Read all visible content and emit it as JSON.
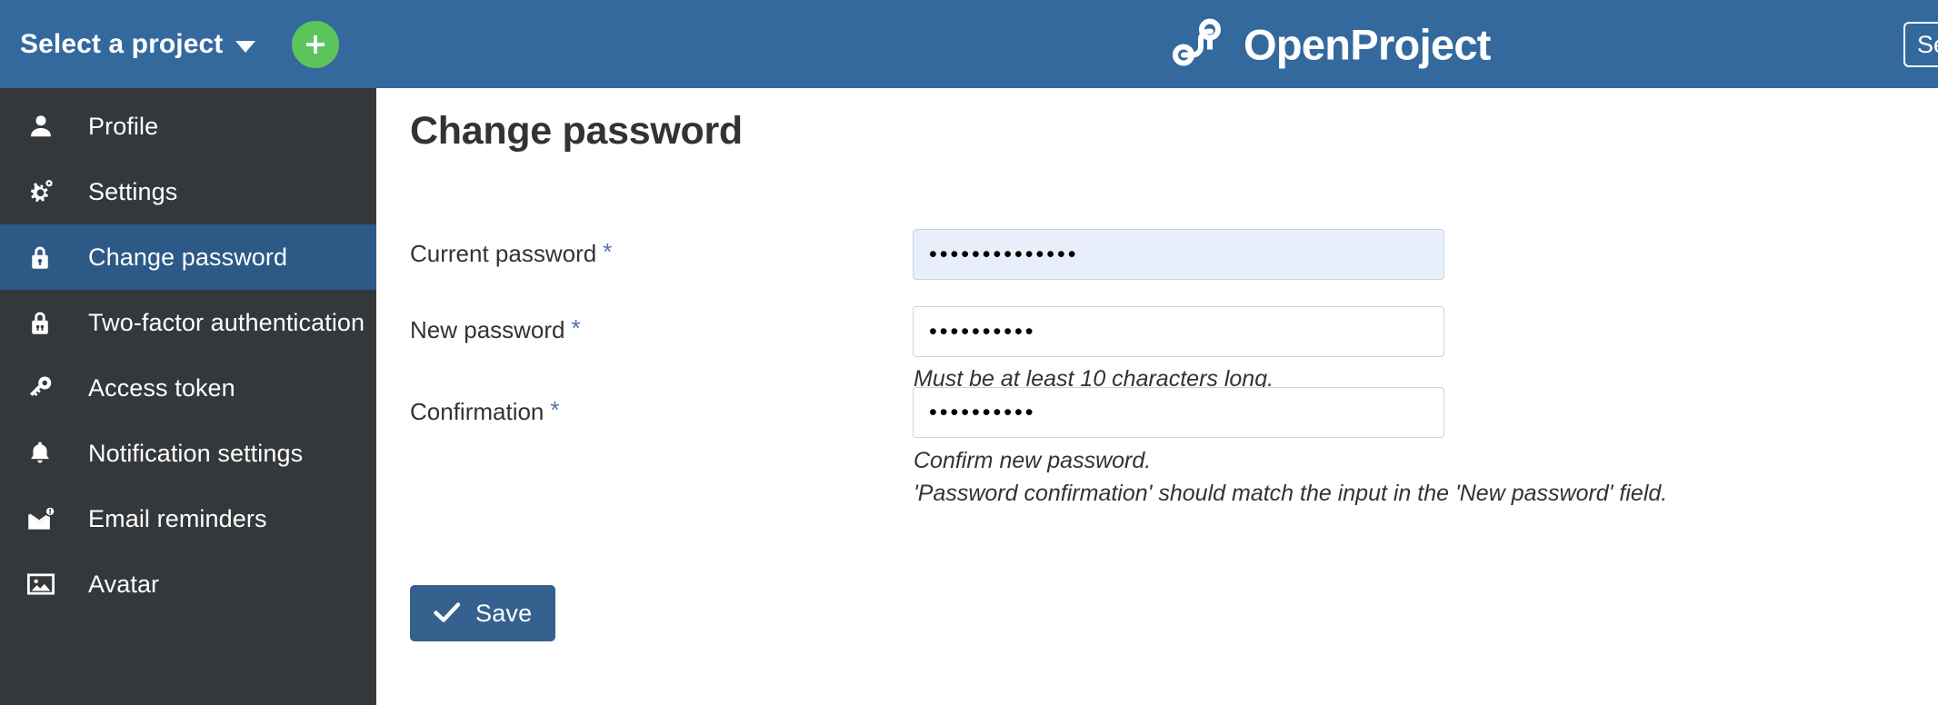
{
  "header": {
    "project_selector_label": "Select a project",
    "project_selector_icon": "chevron-down-icon",
    "add_button_icon": "plus-icon",
    "brand_name": "OpenProject",
    "brand_logo_icon": "openproject-logo-icon",
    "search_value": "Se",
    "search_placeholder": "Search",
    "background_color": "#34699E",
    "add_button_color": "#5BC45B"
  },
  "sidebar": {
    "background_color": "#35383B",
    "active_color": "#2C5986",
    "items": [
      {
        "label": "Profile",
        "icon": "user-icon",
        "active": false
      },
      {
        "label": "Settings",
        "icon": "gears-icon",
        "active": false
      },
      {
        "label": "Change password",
        "icon": "lock-icon",
        "active": true
      },
      {
        "label": "Two-factor authentication",
        "icon": "lock-shield-icon",
        "active": false
      },
      {
        "label": "Access token",
        "icon": "key-icon",
        "active": false
      },
      {
        "label": "Notification settings",
        "icon": "bell-icon",
        "active": false
      },
      {
        "label": "Email reminders",
        "icon": "envelope-alert-icon",
        "active": false
      },
      {
        "label": "Avatar",
        "icon": "image-icon",
        "active": false
      }
    ]
  },
  "main": {
    "page_title": "Change password",
    "required_marker": "*",
    "required_marker_color": "#4E76A9",
    "fields": [
      {
        "label": "Current password",
        "required": true,
        "value": "••••••••••••••",
        "autofilled": true,
        "hints": []
      },
      {
        "label": "New password",
        "required": true,
        "value": "••••••••••",
        "autofilled": false,
        "hints": [
          "Must be at least 10 characters long."
        ]
      },
      {
        "label": "Confirmation",
        "required": true,
        "value": "••••••••••",
        "autofilled": false,
        "hints": [
          "Confirm new password.",
          "'Password confirmation' should match the input in the 'New password' field."
        ]
      }
    ],
    "save_button": {
      "label": "Save",
      "icon": "check-icon",
      "color": "#36618E"
    }
  }
}
